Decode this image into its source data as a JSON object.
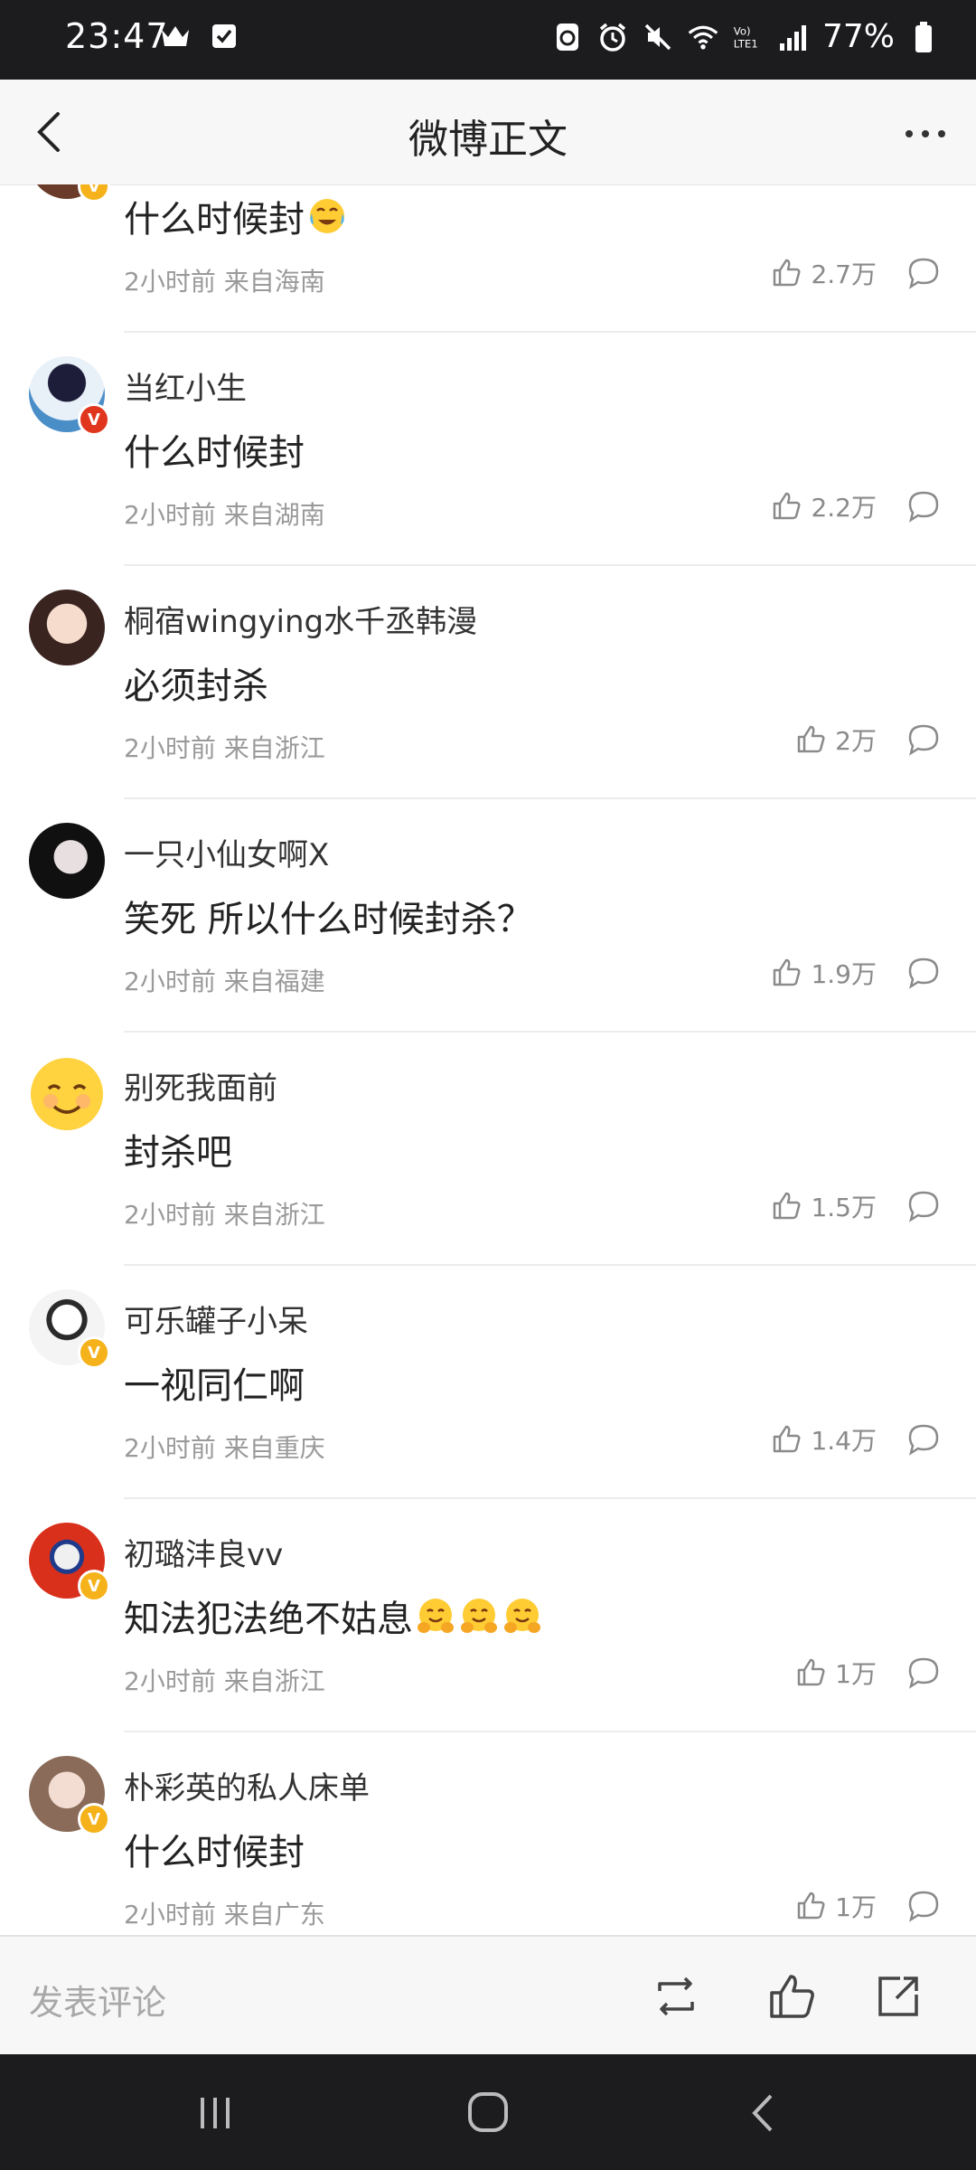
{
  "status_bar": {
    "time": "23:47",
    "battery": "77%"
  },
  "nav": {
    "title": "微博正文"
  },
  "comments": [
    {
      "user": "",
      "text": "什么时候封",
      "has_emoji": "crying-laughing",
      "meta": "2小时前 来自海南",
      "likes": "2.7万",
      "badge": "gold"
    },
    {
      "user": "当红小生",
      "text": "什么时候封",
      "meta": "2小时前 来自湖南",
      "likes": "2.2万",
      "badge": "red"
    },
    {
      "user": "桐宿wingying水千丞韩漫",
      "text": "必须封杀",
      "meta": "2小时前 来自浙江",
      "likes": "2万",
      "badge": ""
    },
    {
      "user": "一只小仙女啊X",
      "text": "笑死 所以什么时候封杀？",
      "meta": "2小时前 来自福建",
      "likes": "1.9万",
      "badge": ""
    },
    {
      "user": "别死我面前",
      "text": "封杀吧",
      "meta": "2小时前 来自浙江",
      "likes": "1.5万",
      "badge": ""
    },
    {
      "user": "可乐罐子小呆",
      "text": "一视同仁啊",
      "meta": "2小时前 来自重庆",
      "likes": "1.4万",
      "badge": "gold"
    },
    {
      "user": "初璐沣良vv",
      "text": "知法犯法绝不姑息",
      "emoji_count": 3,
      "meta": "2小时前 来自浙江",
      "likes": "1万",
      "badge": "gold"
    },
    {
      "user": "朴彩英的私人床单",
      "text": "什么时候封",
      "meta": "2小时前 来自广东",
      "likes": "1万",
      "badge": "gold"
    }
  ],
  "toolbar": {
    "comment_placeholder": "发表评论"
  },
  "badge_letter": "V",
  "colors": {
    "accent_gold": "#f5b21a",
    "accent_red": "#e0361e",
    "status_bg": "#1c1c1f"
  }
}
